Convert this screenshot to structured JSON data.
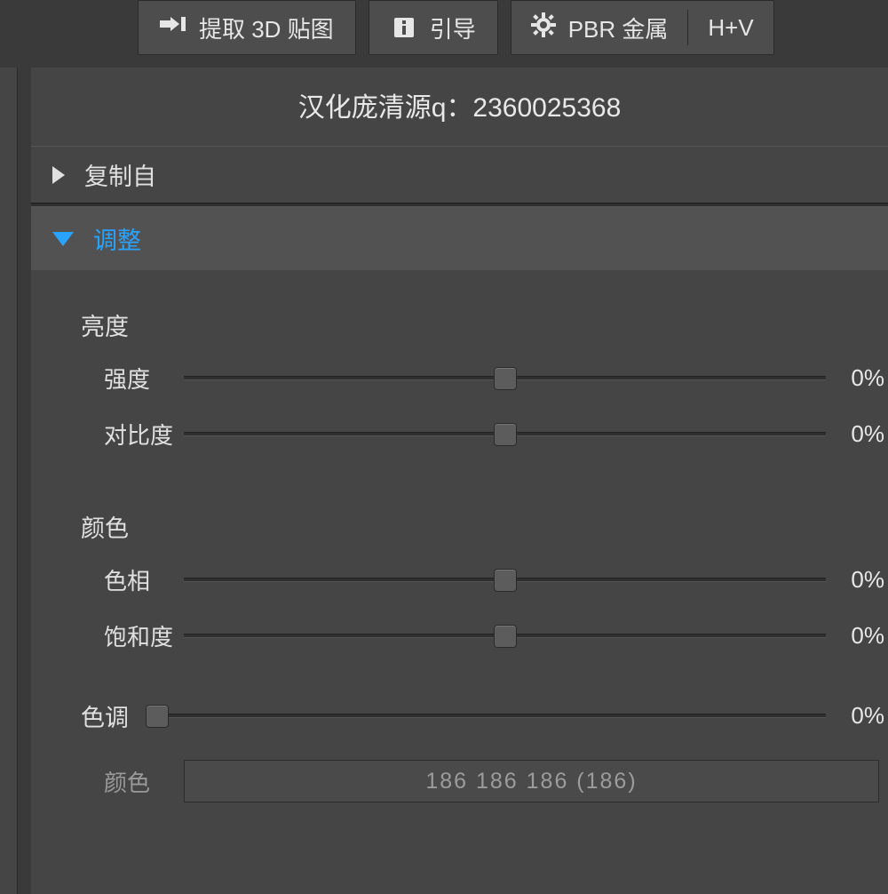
{
  "toolbar": {
    "extract_label": "提取 3D 贴图",
    "guide_label": "引导",
    "pbr_label": "PBR 金属",
    "hv_label": "H+V"
  },
  "panel": {
    "title": "汉化庞清源q：2360025368"
  },
  "sections": {
    "copy_from": {
      "label": "复制自"
    },
    "adjust": {
      "label": "调整"
    }
  },
  "adjust": {
    "brightness_group": "亮度",
    "intensity": {
      "label": "强度",
      "value": "0%"
    },
    "contrast": {
      "label": "对比度",
      "value": "0%"
    },
    "color_group": "颜色",
    "hue": {
      "label": "色相",
      "value": "0%"
    },
    "saturation": {
      "label": "饱和度",
      "value": "0%"
    },
    "tint": {
      "label": "色调",
      "value": "0%"
    },
    "color_field": {
      "label": "颜色",
      "value": "186 186 186 (186)"
    }
  }
}
